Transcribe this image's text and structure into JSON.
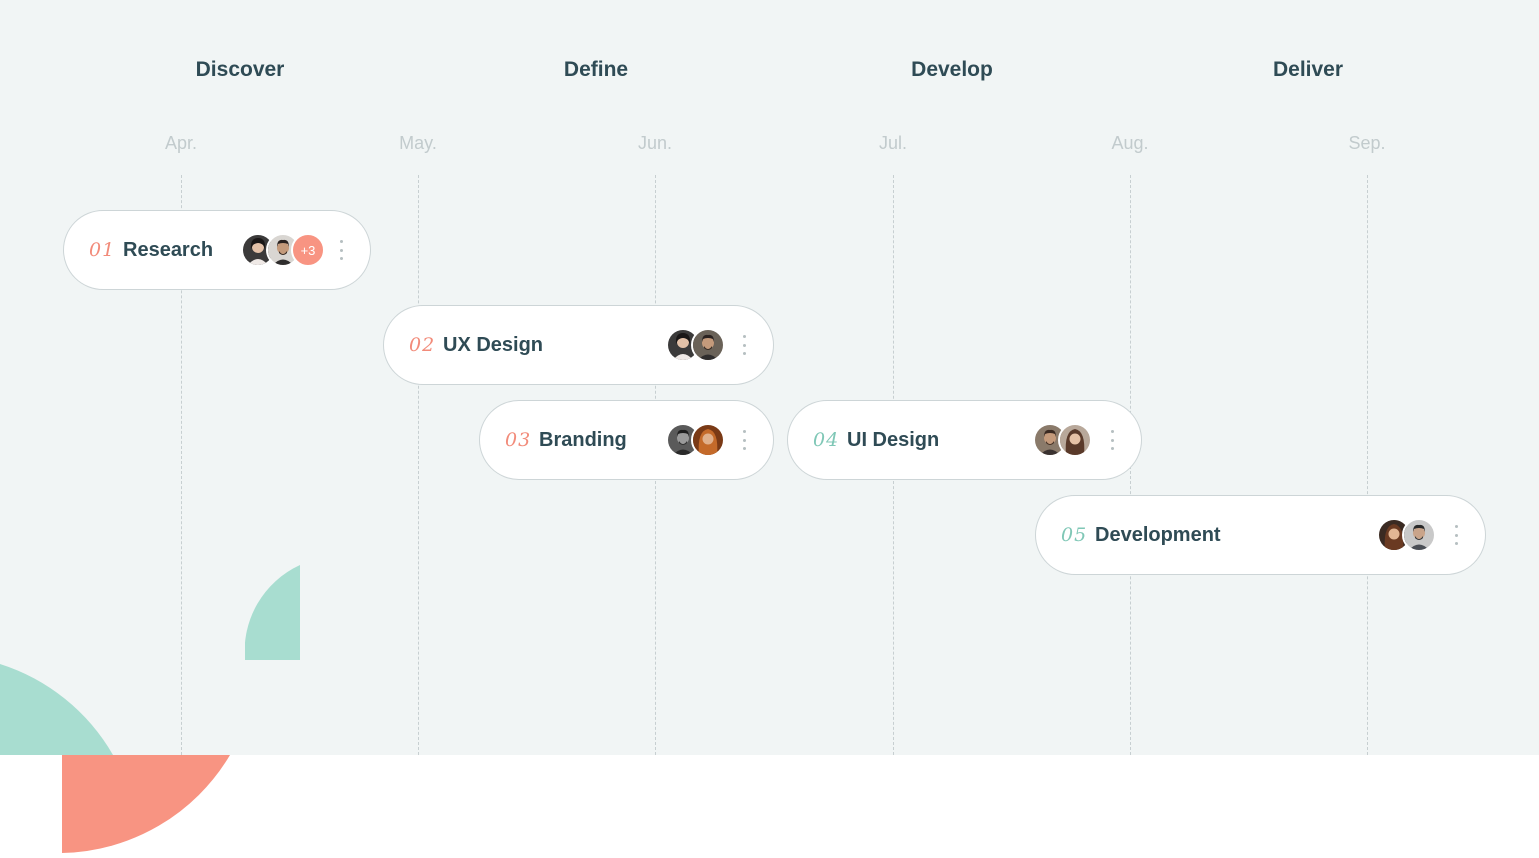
{
  "phases": [
    {
      "label": "Discover"
    },
    {
      "label": "Define"
    },
    {
      "label": "Develop"
    },
    {
      "label": "Deliver"
    }
  ],
  "months": [
    {
      "label": "Apr."
    },
    {
      "label": "May."
    },
    {
      "label": "Jun."
    },
    {
      "label": "Jul."
    },
    {
      "label": "Aug."
    },
    {
      "label": "Sep."
    }
  ],
  "tasks": [
    {
      "number": "01",
      "label": "Research",
      "more_count": "+3",
      "number_color": "#f28b7a"
    },
    {
      "number": "02",
      "label": "UX Design",
      "number_color": "#f28b7a"
    },
    {
      "number": "03",
      "label": "Branding",
      "number_color": "#f28b7a"
    },
    {
      "number": "04",
      "label": "UI Design",
      "number_color": "#7fc7b6"
    },
    {
      "number": "05",
      "label": "Development",
      "number_color": "#7fc7b6"
    }
  ],
  "colors": {
    "background": "#f1f5f5",
    "coral": "#f89482",
    "mint": "#a8ddd0",
    "heading": "#2f4b55",
    "muted": "#c2cbcd"
  }
}
